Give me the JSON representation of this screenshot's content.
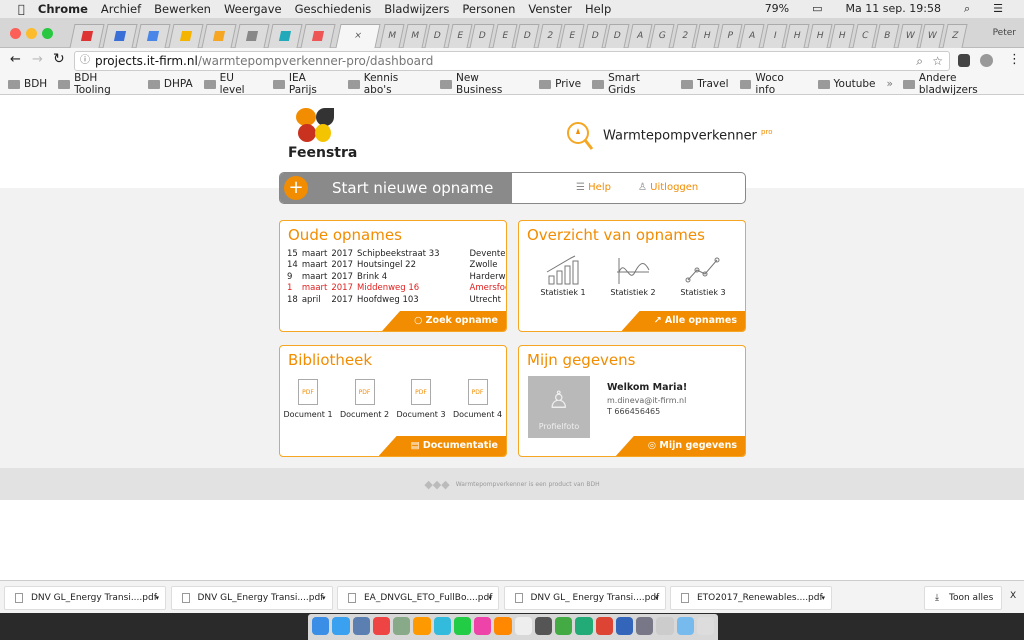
{
  "menubar": {
    "app": "Chrome",
    "items": [
      "Archief",
      "Bewerken",
      "Weergave",
      "Geschiedenis",
      "Bladwijzers",
      "Personen",
      "Venster",
      "Help"
    ],
    "battery": "79%",
    "clock": "Ma 11 sep.  19:58"
  },
  "tabs": {
    "labels": [
      "M",
      "M",
      "D",
      "E",
      "D",
      "E",
      "D",
      "2",
      "E",
      "D",
      "D",
      "A",
      "G",
      "2",
      "H",
      "P",
      "A",
      "I",
      "H",
      "H",
      "H",
      "C",
      "B",
      "W",
      "W",
      "Z"
    ],
    "active_close": "×",
    "profile": "Peter"
  },
  "address": {
    "host": "projects.it-firm.nl",
    "path": "/warmtepompverkenner-pro/dashboard"
  },
  "bookmarks": {
    "items": [
      "BDH",
      "BDH Tooling",
      "DHPA",
      "EU level",
      "IEA Parijs",
      "Kennis abo's",
      "New Business",
      "Prive",
      "Smart Grids",
      "Travel",
      "Woco info",
      "Youtube"
    ],
    "more": "»",
    "other": "Andere bladwijzers"
  },
  "header": {
    "brand": "Feenstra",
    "product": "Warmtepompverkenner",
    "product_tier": "pro"
  },
  "actionbar": {
    "start": "Start nieuwe opname",
    "help": "Help",
    "logout": "Uitloggen"
  },
  "oude_opnames": {
    "title": "Oude opnames",
    "rows": [
      {
        "day": "15",
        "month": "maart",
        "year": "2017",
        "street": "Schipbeekstraat 33",
        "city": "Deventer",
        "alert": false
      },
      {
        "day": "14",
        "month": "maart",
        "year": "2017",
        "street": "Houtsingel 22",
        "city": "Zwolle",
        "alert": false
      },
      {
        "day": "9",
        "month": "maart",
        "year": "2017",
        "street": "Brink 4",
        "city": "Harderwijk",
        "alert": false
      },
      {
        "day": "1",
        "month": "maart",
        "year": "2017",
        "street": "Middenweg 16",
        "city": "Amersfoort",
        "alert": true
      },
      {
        "day": "18",
        "month": "april",
        "year": "2017",
        "street": "Hoofdweg 103",
        "city": "Utrecht",
        "alert": false
      }
    ],
    "alert_symbol": "!",
    "button": "Zoek opname"
  },
  "overzicht": {
    "title": "Overzicht van opnames",
    "stats": [
      "Statistiek 1",
      "Statistiek 2",
      "Statistiek 3"
    ],
    "button": "Alle opnames"
  },
  "bibliotheek": {
    "title": "Bibliotheek",
    "docs": [
      "Document 1",
      "Document 2",
      "Document 3",
      "Document 4"
    ],
    "doc_badge": "PDF",
    "button": "Documentatie"
  },
  "gegevens": {
    "title": "Mijn gegevens",
    "photo": "Profielfoto",
    "welcome": "Welkom Maria!",
    "email": "m.dineva@it-firm.nl",
    "phone": "T 666456465",
    "button": "Mijn gegevens"
  },
  "footer": {
    "text": "Warmtepompverkenner is een product van BDH"
  },
  "downloads": {
    "files": [
      "DNV GL_Energy Transi....pdf",
      "DNV GL_Energy Transi....pdf",
      "EA_DNVGL_ETO_FullBo....pdf",
      "DNV GL_ Energy Transi....pdf",
      "ETO2017_Renewables....pdf"
    ],
    "show_all": "Toon alles",
    "close": "X"
  },
  "colors": {
    "accent": "#f28c00",
    "alert": "#e02020",
    "gray_button": "#8a8a8a"
  }
}
